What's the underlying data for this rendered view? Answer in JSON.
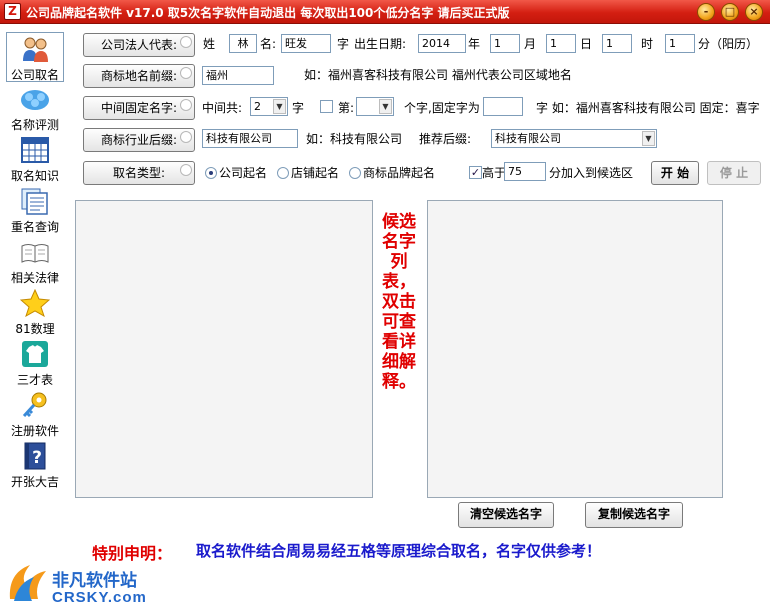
{
  "window": {
    "title": "公司品牌起名软件 v17.0  取5次名字软件自动退出 每次取出100个低分名字 请后买正式版",
    "app_icon_char": "Z",
    "minimize_glyph": "-",
    "maximize_glyph": "□",
    "close_glyph": "×"
  },
  "nav": [
    {
      "label": "公司取名",
      "icon": "people-icon"
    },
    {
      "label": "名称评测",
      "icon": "cloud-people-icon"
    },
    {
      "label": "取名知识",
      "icon": "calendar-grid-icon"
    },
    {
      "label": "重名查询",
      "icon": "document-stack-icon"
    },
    {
      "label": "相关法律",
      "icon": "open-book-icon"
    },
    {
      "label": "81数理",
      "icon": "star-icon"
    },
    {
      "label": "三才表",
      "icon": "shirt-icon"
    },
    {
      "label": "注册软件",
      "icon": "key-icon"
    },
    {
      "label": "开张大吉",
      "icon": "help-book-icon"
    }
  ],
  "row1": {
    "button": "公司法人代表:",
    "surname_label": "姓",
    "surname_value": "林",
    "name_label": "名:",
    "name_value": "旺发",
    "zi_label": "字",
    "birth_label": "出生日期:",
    "year": "2014",
    "year_unit": "年",
    "month": "1",
    "month_unit": "月",
    "day": "1",
    "day_unit": "日",
    "hour": "1",
    "hour_unit": "时",
    "minute": "1",
    "minute_unit": "分（阳历）"
  },
  "row2": {
    "button": "商标地名前缀:",
    "value": "福州",
    "example": "如：福州喜客科技有限公司 福州代表公司区域地名"
  },
  "row3": {
    "button": "中间固定名字:",
    "total_label": "中间共:",
    "total_value": "2",
    "zi_label": "字",
    "position_label": "第:",
    "position_value": "",
    "fixed_label": "个字,固定字为",
    "fixed_value": "",
    "example": "字 如：福州喜客科技有限公司 固定：喜字"
  },
  "row4": {
    "button": "商标行业后缀:",
    "value": "科技有限公司",
    "example": "如：科技有限公司",
    "recommend_label": "推荐后缀:",
    "recommend_value": "科技有限公司"
  },
  "row5": {
    "button": "取名类型:",
    "options": [
      "公司起名",
      "店铺起名",
      "商标品牌起名"
    ],
    "selected_index": 0,
    "above_label": "高于",
    "above_checked": true,
    "threshold_value": "75",
    "threshold_suffix": "分加入到候选区",
    "start_button": "开 始",
    "stop_button": "停 止"
  },
  "hint": "候选名字列表，双击可查看详细解释。",
  "bottom_buttons": {
    "clear": "清空候选名字",
    "copy": "复制候选名字"
  },
  "notice": {
    "label": "特别申明：",
    "text": "取名软件结合周易易经五格等原理综合取名，名字仅供参考！"
  },
  "watermark": {
    "title": "非凡软件站",
    "domain": "CRSKY.com"
  },
  "colors": {
    "titlebar": "#d41f12",
    "hint_red": "#e00000",
    "notice_blue": "#1a1acc",
    "watermark_blue": "#2367c9"
  }
}
